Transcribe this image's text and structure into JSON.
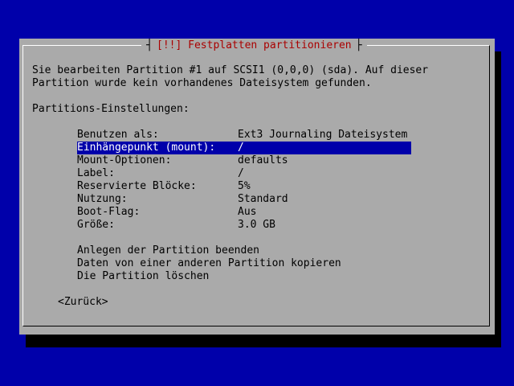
{
  "dialog": {
    "title": "[!!] Festplatten partitionieren",
    "title_color": "#aa0000",
    "description_line1": "Sie bearbeiten Partition #1 auf SCSI1 (0,0,0) (sda). Auf dieser",
    "description_line2": "Partition wurde kein vorhandenes Dateisystem gefunden.",
    "section_label": "Partitions-Einstellungen:"
  },
  "settings": [
    {
      "label": "Benutzen als:",
      "value": "Ext3 Journaling Dateisystem"
    },
    {
      "label": "Einhängepunkt (mount):",
      "value": "/"
    },
    {
      "label": "Mount-Optionen:",
      "value": "defaults"
    },
    {
      "label": "Label:",
      "value": "/"
    },
    {
      "label": "Reservierte Blöcke:",
      "value": "5%"
    },
    {
      "label": "Nutzung:",
      "value": "Standard"
    },
    {
      "label": "Boot-Flag:",
      "value": "Aus"
    },
    {
      "label": "Größe:",
      "value": "3.0 GB"
    }
  ],
  "actions": [
    {
      "label": "Anlegen der Partition beenden"
    },
    {
      "label": "Daten von einer anderen Partition kopieren"
    },
    {
      "label": "Die Partition löschen"
    }
  ],
  "back_button": "<Zurück>",
  "colors": {
    "background": "#0000aa",
    "dialog": "#aaaaaa",
    "selection": "#0000aa",
    "selection_text": "#ffffff"
  }
}
